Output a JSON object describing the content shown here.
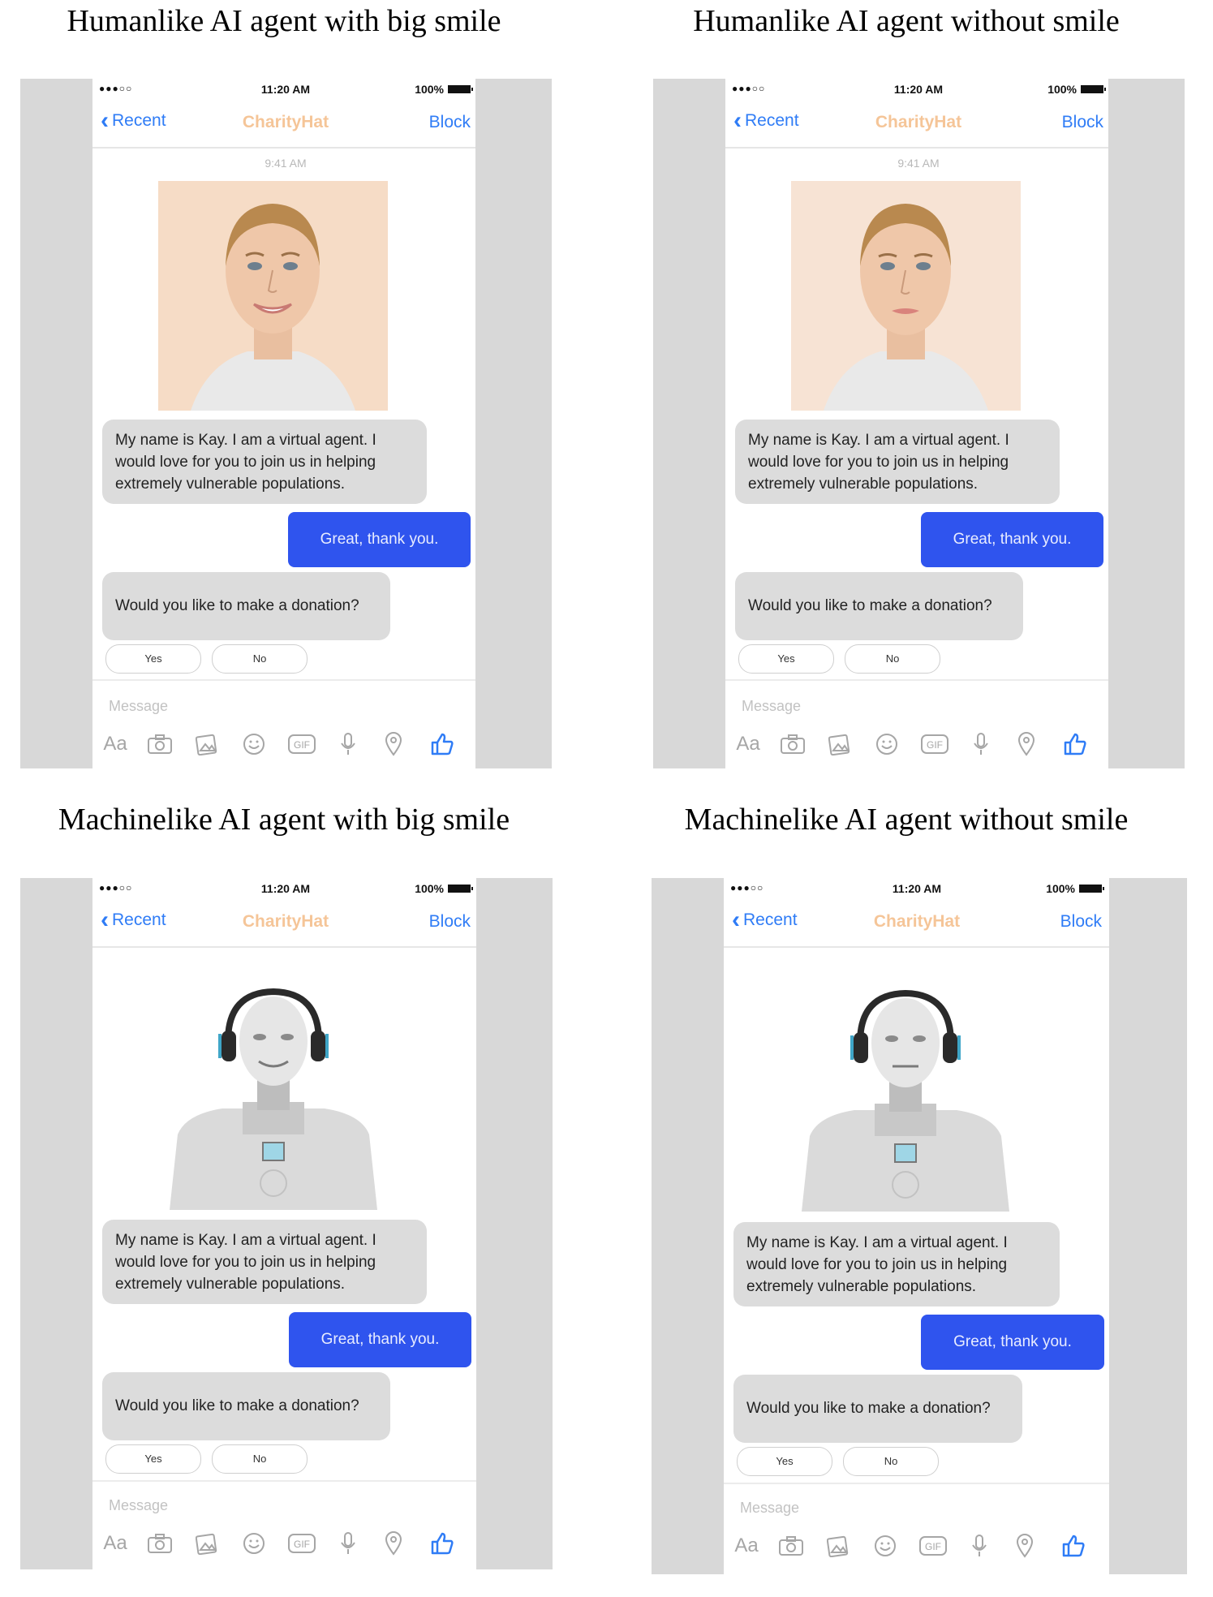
{
  "panels": [
    {
      "title": "Humanlike AI agent with big smile",
      "avatar": "human-smiling",
      "status": {
        "signal": "●●●○○",
        "time": "11:20 AM",
        "battery": "100%"
      },
      "nav": {
        "back": "Recent",
        "brand": "CharityHat",
        "block": "Block"
      },
      "timestamp": "9:41 AM",
      "messages": {
        "intro": "My name is Kay. I am a virtual agent. I would love for you to join us in helping extremely vulnerable populations.",
        "reply": "Great, thank you.",
        "question": "Would you like to make a donation?"
      },
      "quick_replies": [
        "Yes",
        "No"
      ],
      "composer": {
        "placeholder": "Message",
        "aa": "Aa",
        "gif": "GIF"
      }
    },
    {
      "title": "Humanlike AI agent without smile",
      "avatar": "human-neutral",
      "status": {
        "signal": "●●●○○",
        "time": "11:20 AM",
        "battery": "100%"
      },
      "nav": {
        "back": "Recent",
        "brand": "CharityHat",
        "block": "Block"
      },
      "timestamp": "9:41 AM",
      "messages": {
        "intro": "My name is Kay. I am a virtual agent. I would love for you to join us in helping extremely vulnerable populations.",
        "reply": "Great, thank you.",
        "question": "Would you like to make a donation?"
      },
      "quick_replies": [
        "Yes",
        "No"
      ],
      "composer": {
        "placeholder": "Message",
        "aa": "Aa",
        "gif": "GIF"
      }
    },
    {
      "title": "Machinelike AI agent with big smile",
      "avatar": "robot-smiling",
      "status": {
        "signal": "●●●○○",
        "time": "11:20 AM",
        "battery": "100%"
      },
      "nav": {
        "back": "Recent",
        "brand": "CharityHat",
        "block": "Block"
      },
      "timestamp": "",
      "messages": {
        "intro": "My name is Kay. I am a virtual agent. I would love for you to join us in helping extremely vulnerable populations.",
        "reply": "Great, thank you.",
        "question": "Would you like to make a donation?"
      },
      "quick_replies": [
        "Yes",
        "No"
      ],
      "composer": {
        "placeholder": "Message",
        "aa": "Aa",
        "gif": "GIF"
      }
    },
    {
      "title": "Machinelike AI agent without smile",
      "avatar": "robot-neutral",
      "status": {
        "signal": "●●●○○",
        "time": "11:20 AM",
        "battery": "100%"
      },
      "nav": {
        "back": "Recent",
        "brand": "CharityHat",
        "block": "Block"
      },
      "timestamp": "",
      "messages": {
        "intro": "My name is Kay. I am a virtual agent. I would love for you to join us in helping extremely vulnerable populations.",
        "reply": "Great, thank you.",
        "question": "Would you like to make a donation?"
      },
      "quick_replies": [
        "Yes",
        "No"
      ],
      "composer": {
        "placeholder": "Message",
        "aa": "Aa",
        "gif": "GIF"
      }
    }
  ],
  "colors": {
    "accent": "#2f7cf6",
    "brand": "#f5c598",
    "outgoing_bubble": "#2f54ee",
    "incoming_bubble": "#dcdcdc",
    "frame": "#d8d8d8"
  },
  "icons": [
    "camera-icon",
    "photo-icon",
    "emoji-icon",
    "gif-icon",
    "microphone-icon",
    "location-icon",
    "thumbs-up-icon"
  ]
}
